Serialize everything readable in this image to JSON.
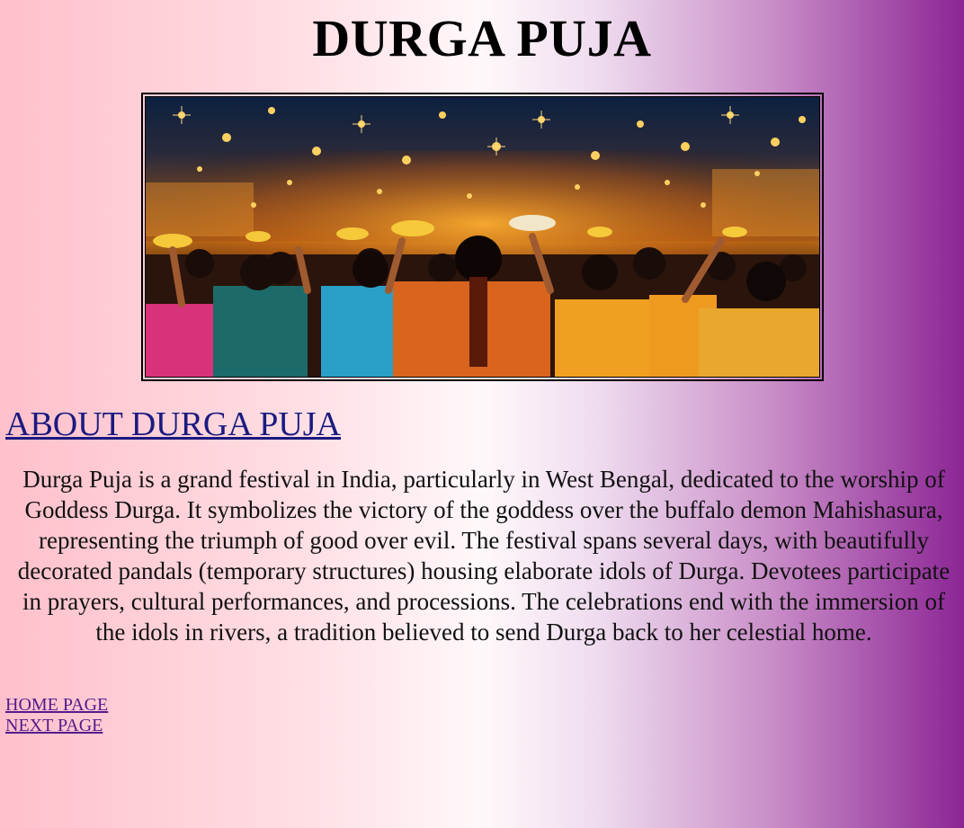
{
  "page": {
    "title": "DURGA PUJA"
  },
  "hero": {
    "image_description_icon": "festival-crowd-image"
  },
  "about": {
    "heading": "ABOUT DURGA PUJA",
    "body": "Durga Puja is a grand festival in India, particularly in West Bengal, dedicated to the worship of Goddess Durga. It symbolizes the victory of the goddess over the buffalo demon Mahishasura, representing the triumph of good over evil. The festival spans several days, with beautifully decorated pandals (temporary structures) housing elaborate idols of Durga. Devotees participate in prayers, cultural performances, and processions. The celebrations end with the immersion of the idols in rivers, a tradition believed to send Durga back to her celestial home."
  },
  "nav": {
    "links": [
      {
        "label": "HOME PAGE"
      },
      {
        "label": "NEXT PAGE"
      }
    ]
  },
  "colors": {
    "gradient_left": "#ffc0cb",
    "gradient_right": "#8c2595",
    "heading_link": "#1a1a80",
    "visited_link": "#551a8b"
  }
}
